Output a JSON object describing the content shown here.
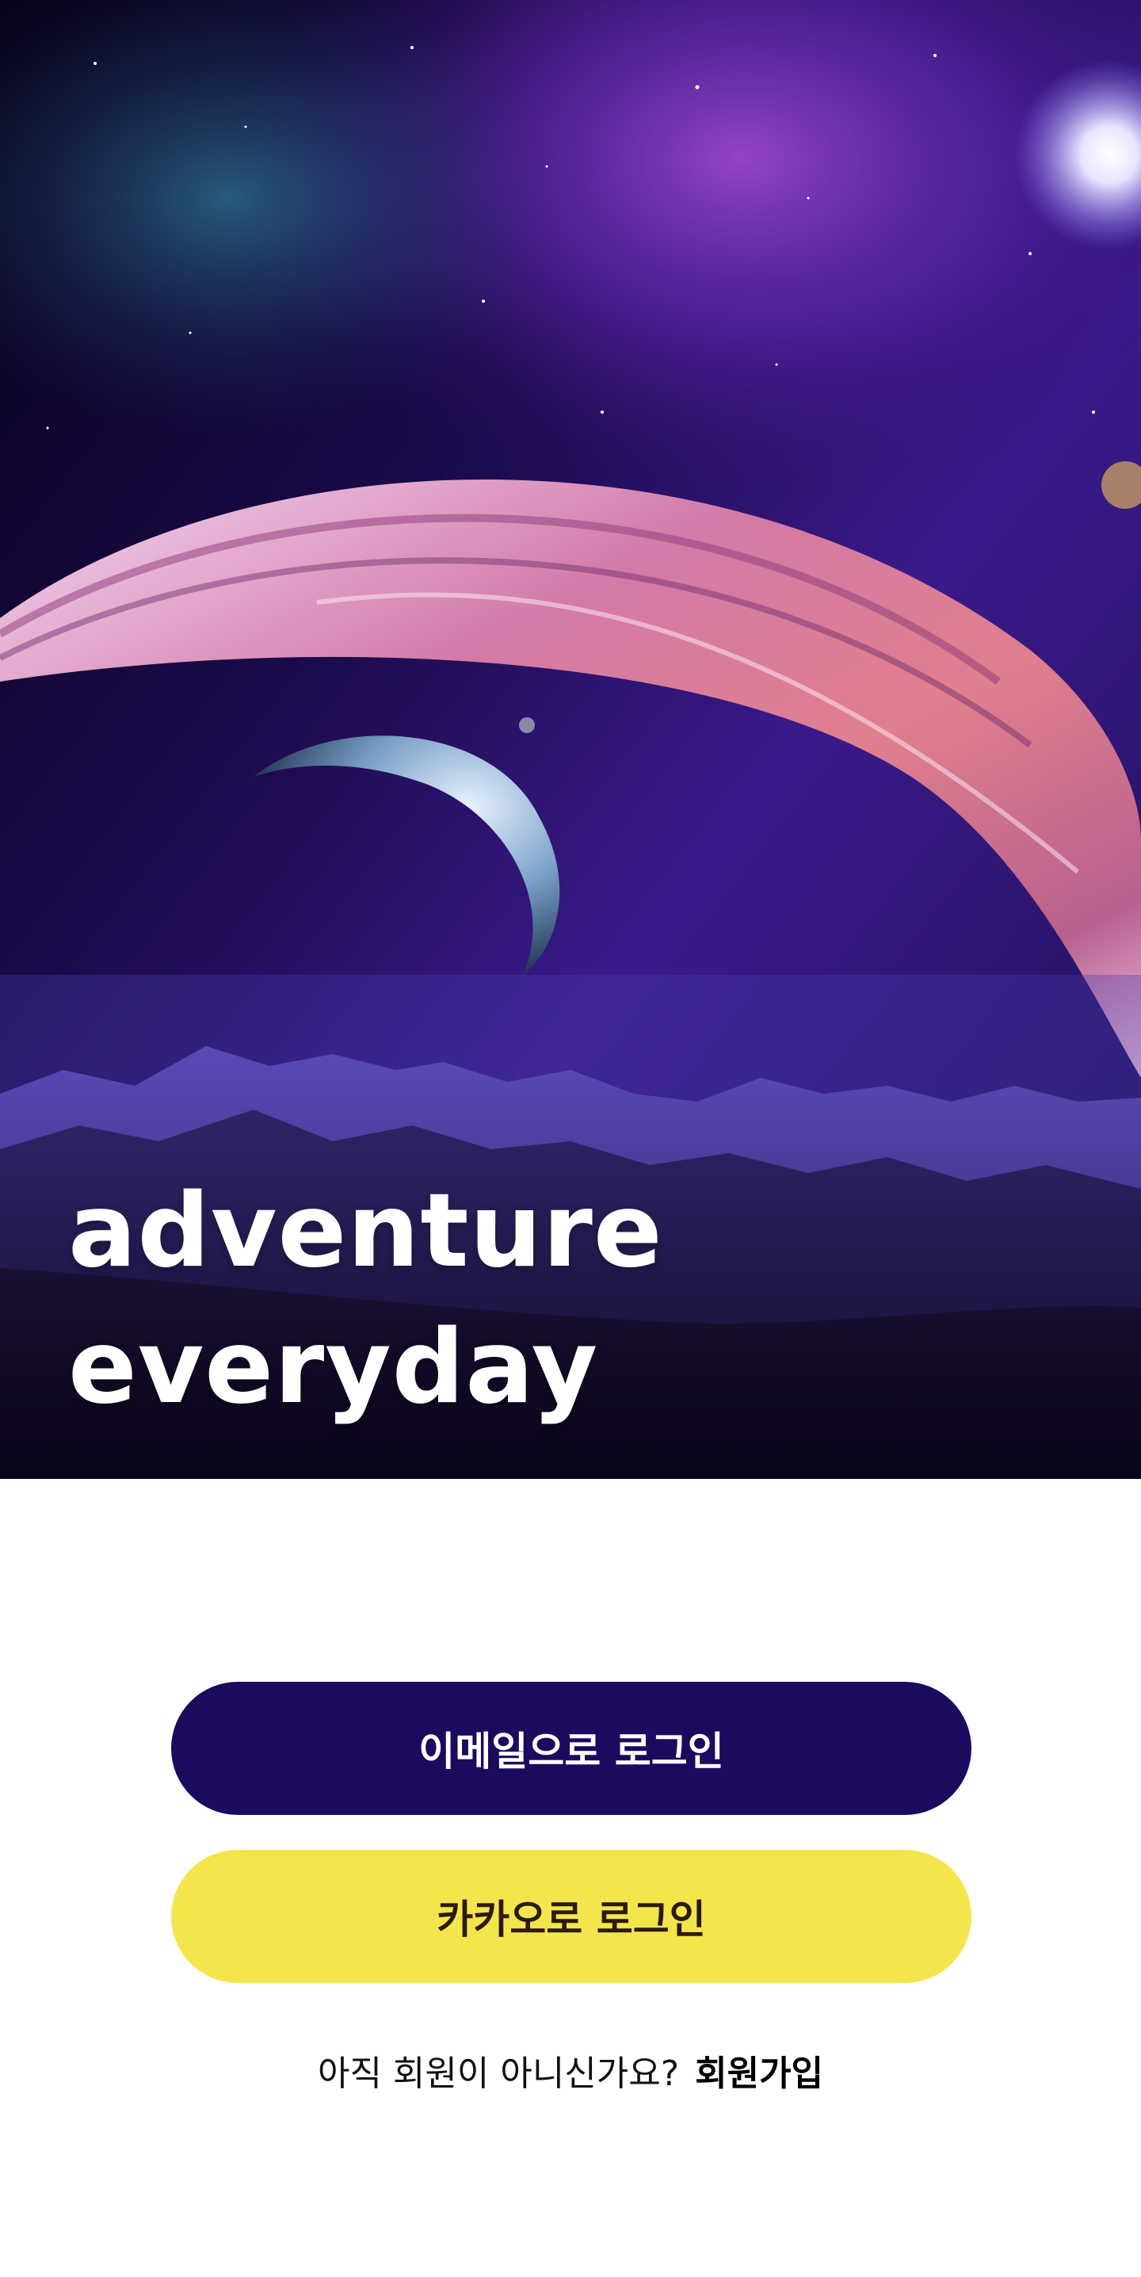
{
  "hero": {
    "title_line1": "adventure",
    "title_line2": "everyday",
    "background": "space-planet-illustration"
  },
  "login": {
    "email_button_label": "이메일으로 로그인",
    "kakao_button_label": "카카오로 로그인"
  },
  "signup": {
    "prompt": "아직 회원이 아니신가요?",
    "link_label": "회원가입"
  },
  "colors": {
    "email_button_bg": "#1c0a5e",
    "kakao_button_bg": "#f4e54c",
    "kakao_button_text": "#2b1a12",
    "page_bg": "#ffffff"
  }
}
